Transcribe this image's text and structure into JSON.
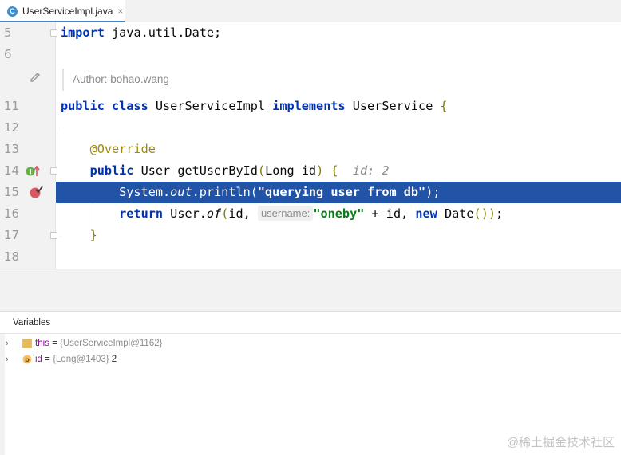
{
  "tab": {
    "icon_letter": "C",
    "filename": "UserServiceImpl.java",
    "close": "×"
  },
  "editor": {
    "author_hint": "Author: bohao.wang",
    "lines": [
      {
        "num": "5",
        "code": "import java.util.Date;"
      },
      {
        "num": "6",
        "code": ""
      },
      {
        "num": "11",
        "code": "public class UserServiceImpl implements UserService {"
      },
      {
        "num": "12",
        "code": ""
      },
      {
        "num": "13",
        "code": "@Override"
      },
      {
        "num": "14",
        "code": "public User getUserById(Long id) {",
        "inline_hint": "id: 2"
      },
      {
        "num": "15",
        "code": "System.out.println(\"querying user from db\");"
      },
      {
        "num": "16",
        "code": "return User.of(id, username: \"oneby\" + id, new Date());",
        "param_hint": "username:"
      },
      {
        "num": "17",
        "code": "}"
      },
      {
        "num": "18",
        "code": ""
      }
    ]
  },
  "variables": {
    "title": "Variables",
    "rows": [
      {
        "name": "this",
        "eq": " = ",
        "type": "{UserServiceImpl@1162}",
        "value": ""
      },
      {
        "name": "id",
        "eq": " = ",
        "type": "{Long@1403}",
        "value": " 2"
      }
    ]
  },
  "watermark": "@稀土掘金技术社区",
  "colors": {
    "highlight": "#2154a6",
    "keyword": "#0033b3",
    "string": "#067d17",
    "annotation": "#9e880d"
  }
}
